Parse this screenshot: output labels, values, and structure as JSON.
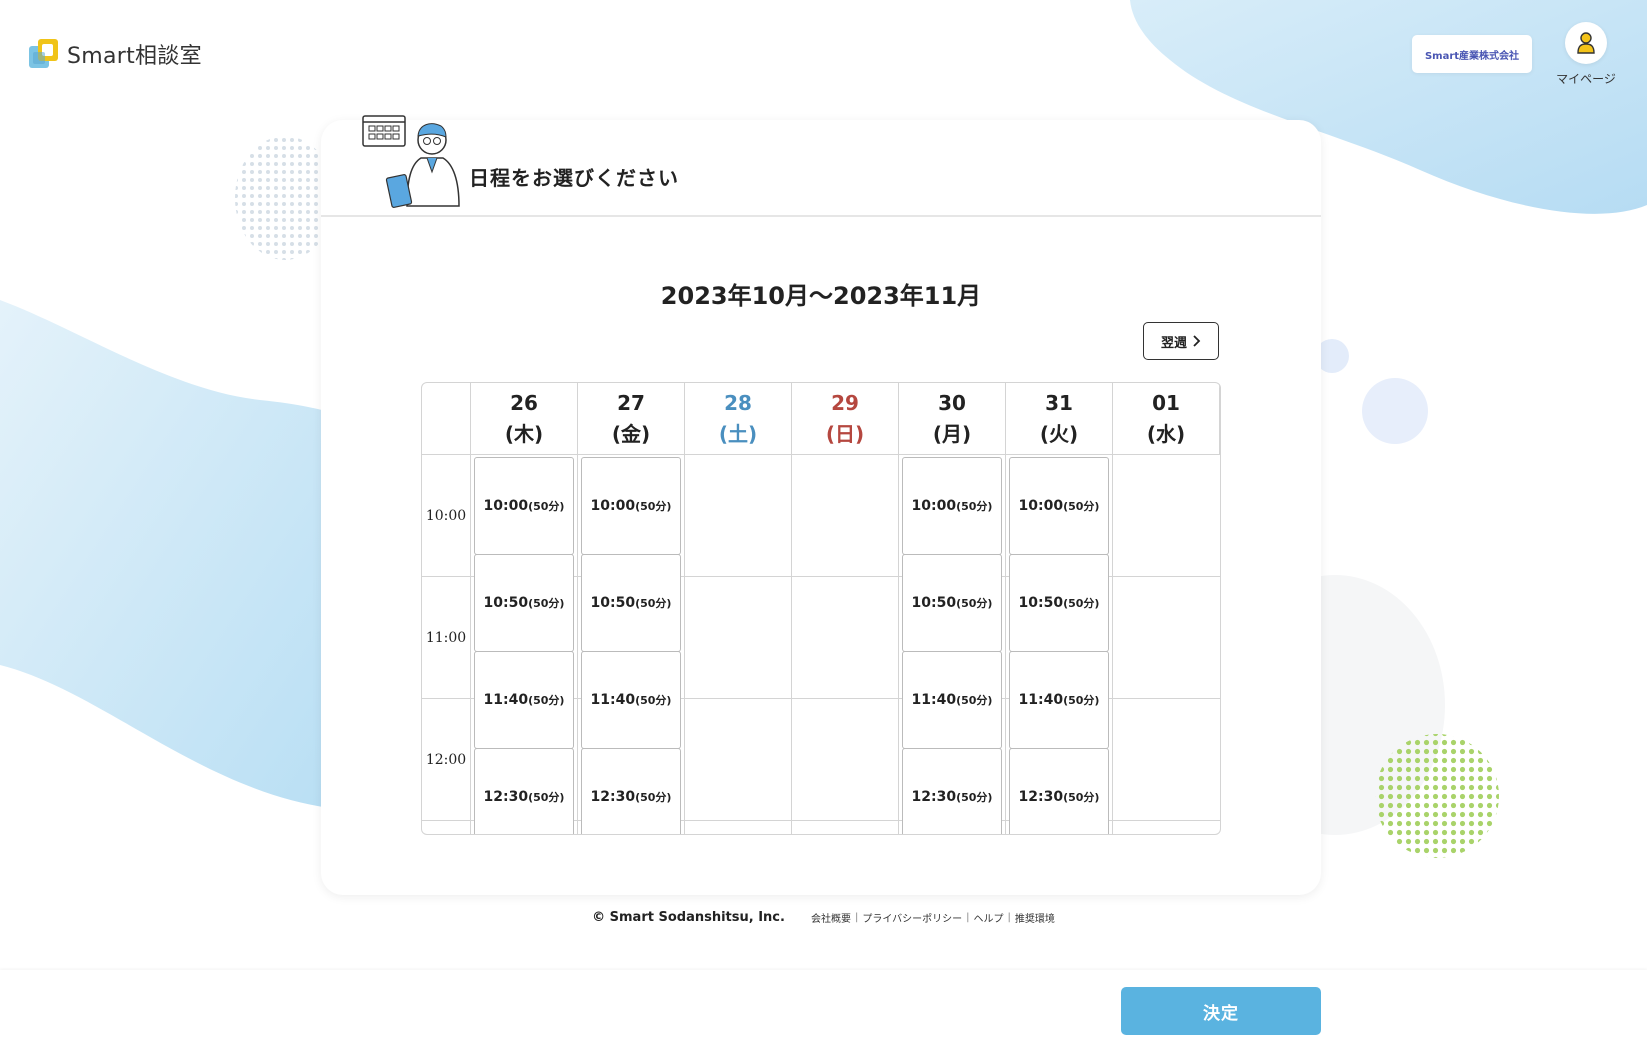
{
  "app": {
    "logo_text": "Smart相談室"
  },
  "header": {
    "company_name": "Smart産業株式会社",
    "mypage_label": "マイページ"
  },
  "card": {
    "title": "日程をお選びください"
  },
  "calendar": {
    "period": "2023年10月～2023年11月",
    "next_week_label": "翌週",
    "days": [
      {
        "date": "26",
        "weekday": "(木)",
        "color": "#222222"
      },
      {
        "date": "27",
        "weekday": "(金)",
        "color": "#222222"
      },
      {
        "date": "28",
        "weekday": "(土)",
        "color": "#4a8fbf"
      },
      {
        "date": "29",
        "weekday": "(日)",
        "color": "#b5473f"
      },
      {
        "date": "30",
        "weekday": "(月)",
        "color": "#222222"
      },
      {
        "date": "31",
        "weekday": "(火)",
        "color": "#222222"
      },
      {
        "date": "01",
        "weekday": "(水)",
        "color": "#222222"
      }
    ],
    "hours": [
      "10:00",
      "11:00",
      "12:00"
    ],
    "slot_duration": "(50分)",
    "slot_times": [
      "10:00",
      "10:50",
      "11:40",
      "12:30"
    ],
    "available_day_indexes": [
      0,
      1,
      4,
      5
    ]
  },
  "footer": {
    "copyright": "© Smart Sodanshitsu, Inc.",
    "links": [
      "会社概要",
      "プライバシーポリシー",
      "ヘルプ",
      "推奨環境"
    ]
  },
  "actions": {
    "confirm_label": "決定"
  },
  "colors": {
    "accent": "#5ab3e0",
    "saturday": "#4a8fbf",
    "sunday": "#b5473f",
    "brand": "#4a56b3"
  }
}
